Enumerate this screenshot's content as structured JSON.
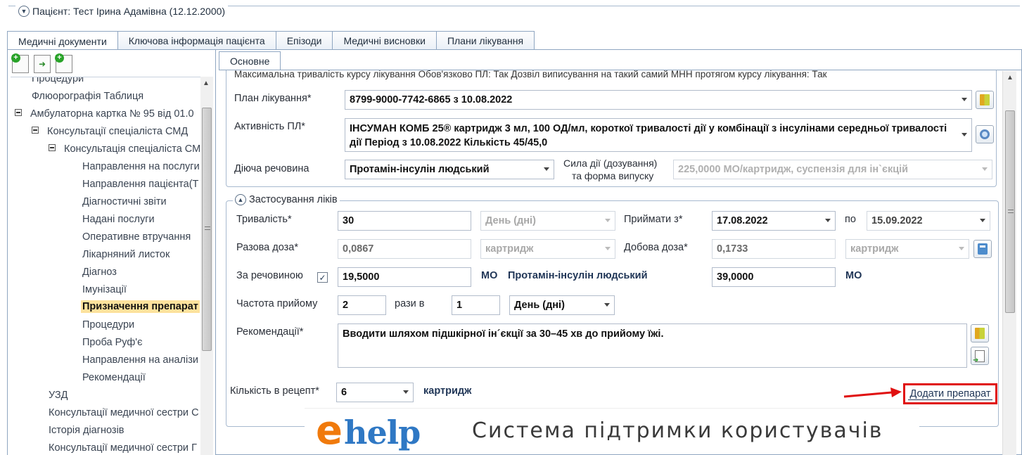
{
  "patient": {
    "title": "Пацієнт: Тест Ірина Адамівна (12.12.2000)"
  },
  "main_tabs": [
    {
      "label": "Медичні документи"
    },
    {
      "label": "Ключова інформація пацієнта"
    },
    {
      "label": "Епізоди"
    },
    {
      "label": "Медичні висновки"
    },
    {
      "label": "Плани лікування"
    }
  ],
  "tree": {
    "items": [
      {
        "label": "Процедури"
      },
      {
        "label": "Флюорографія Таблиця"
      },
      {
        "label": "Амбулаторна картка № 95 від 01.0"
      },
      {
        "label": "Консультації спеціаліста СМД"
      },
      {
        "label": "Консультація спеціаліста СМ"
      },
      {
        "label": "Направлення на послуги"
      },
      {
        "label": "Направлення пацієнта(Т"
      },
      {
        "label": "Діагностичні звіти"
      },
      {
        "label": "Надані послуги"
      },
      {
        "label": "Оперативне втручання"
      },
      {
        "label": "Лікарняний листок"
      },
      {
        "label": "Діагноз"
      },
      {
        "label": "Імунізації"
      },
      {
        "label": "Призначення препарат"
      },
      {
        "label": "Процедури"
      },
      {
        "label": "Проба Руф'є"
      },
      {
        "label": "Направлення на аналізи"
      },
      {
        "label": "Рекомендації"
      },
      {
        "label": "УЗД"
      },
      {
        "label": "Консультації медичної сестри С"
      },
      {
        "label": "Історія діагнозів"
      },
      {
        "label": "Консультації медичної сестри Г"
      }
    ]
  },
  "sub_tab": {
    "label": "Основне"
  },
  "form": {
    "top_line": "Максимальна тривалість курсу лікування    Обов'язково ПЛ:  Так   Дозвіл виписування на такий самий МНН протягом курсу лікування:  Так",
    "plan_label": "План лікування*",
    "plan_value": "8799-9000-7742-6865 з 10.08.2022",
    "activity_label": "Активність ПЛ*",
    "activity_value": "ІНСУМАН КОМБ 25® картридж 3 мл, 100 ОД/мл, короткої тривалості дії у комбінації з інсулінами середньої тривалості дії Період з 10.08.2022 Кількість 45/45,0",
    "substance_label": "Діюча речовина",
    "substance_value": "Протамін-інсулін людський",
    "strength_label_1": "Сила дії (дозування)",
    "strength_label_2": "та форма випуску",
    "strength_value": "225,0000 МО/картридж, суспензія для ін`єкцій"
  },
  "usage": {
    "legend": "Застосування ліків",
    "duration_label": "Тривалість*",
    "duration_value": "30",
    "duration_unit": "День (дні)",
    "take_from_label": "Приймати з*",
    "take_from_value": "17.08.2022",
    "to_label": "по",
    "to_value": "15.09.2022",
    "single_dose_label": "Разова доза*",
    "single_dose_value": "0,0867",
    "single_dose_unit": "картридж",
    "daily_dose_label": "Добова доза*",
    "daily_dose_value": "0,1733",
    "daily_dose_unit": "картридж",
    "by_substance_label": "За речовиною",
    "by_substance_checked": "✓",
    "by_substance_value": "19,5000",
    "mo_unit_1": "МО",
    "substance_name": "Протамін-інсулін людський",
    "substance_daily_value": "39,0000",
    "mo_unit_2": "МО",
    "frequency_label": "Частота прийому",
    "frequency_value": "2",
    "times_in_label": "рази в",
    "times_in_value": "1",
    "period_value": "День (дні)",
    "recommendations_label": "Рекомендації*",
    "recommendations_value": "Вводити шляхом підшкірної ін´єкції за 30–45 хв до прийому їжі."
  },
  "prescription": {
    "qty_label": "Кількість в рецепт*",
    "qty_value": "6",
    "qty_unit": "картридж",
    "add_button": "Додати препарат"
  },
  "ehelp": {
    "logo_e": "e",
    "logo_help": "help",
    "tagline": "Система підтримки користувачів"
  },
  "colors": {
    "border": "#8fa6c1",
    "selected_item": "#fde29d",
    "highlight_red": "#e01010",
    "ehelp_orange": "#f07a0c",
    "ehelp_blue": "#2f78c4"
  }
}
